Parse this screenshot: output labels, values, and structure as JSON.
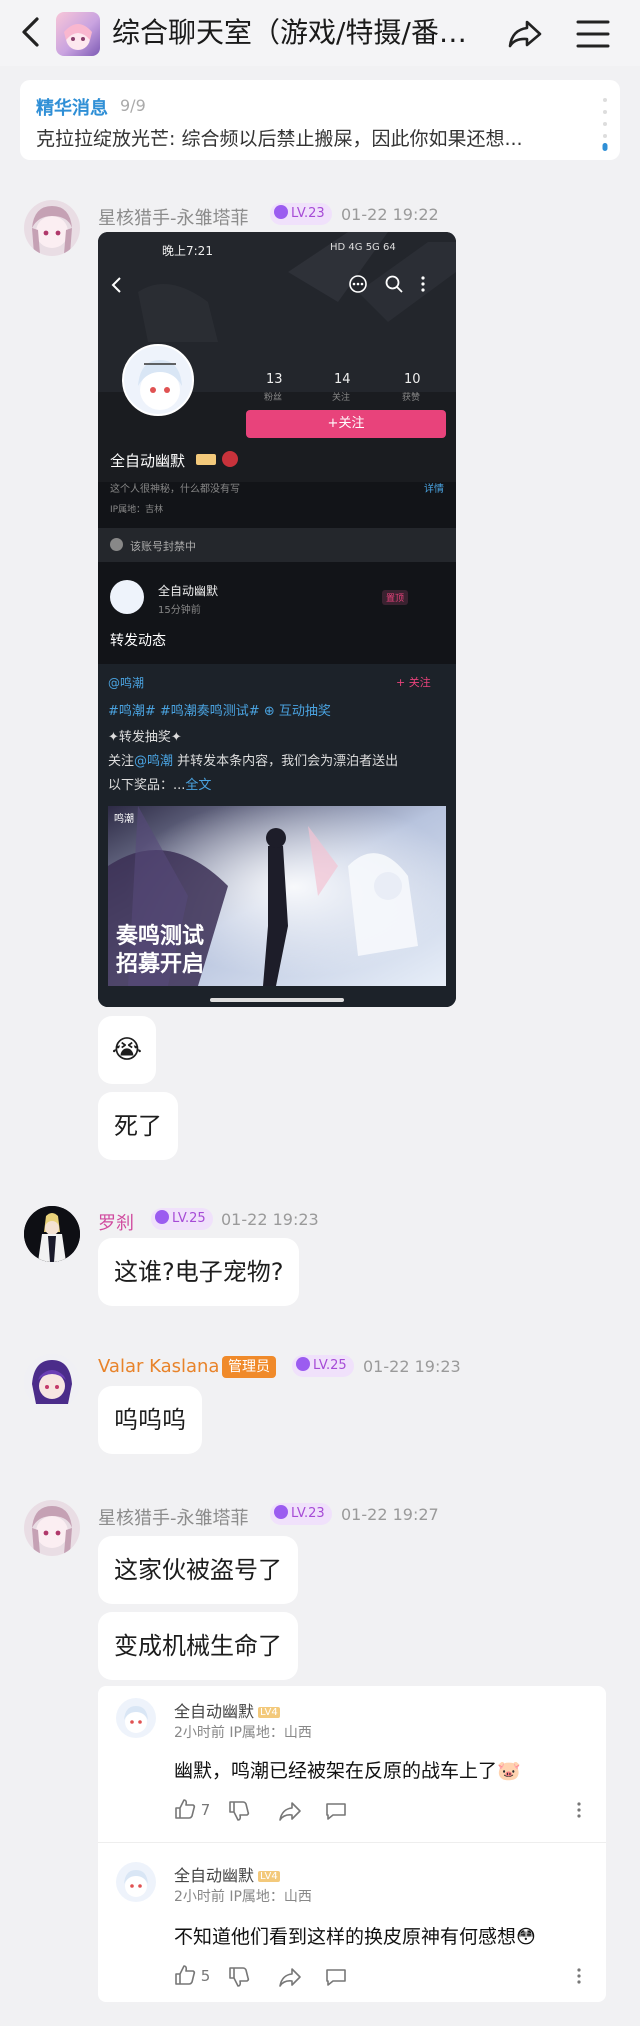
{
  "header": {
    "title": "综合聊天室（游戏/特摄/番剧/...",
    "back_icon": "back-icon",
    "share_icon": "share-icon",
    "menu_icon": "menu-icon"
  },
  "pinned": {
    "label": "精华消息",
    "count": "9/9",
    "text": "克拉拉绽放光芒: 综合频以后禁止搬屎，因此你如果还想..."
  },
  "messages": [
    {
      "user": "星核猎手-永雏塔菲",
      "level": "LV.23",
      "time": "01-22 19:22"
    },
    {
      "user": "罗刹",
      "level": "LV.25",
      "time": "01-22 19:23",
      "text": "这谁?电子宠物?"
    },
    {
      "user": "Valar Kaslana",
      "badge": "管理员",
      "level": "LV.25",
      "time": "01-22 19:23",
      "text": "呜呜呜"
    },
    {
      "user": "星核猎手-永雏塔菲",
      "level": "LV.23",
      "time": "01-22 19:27",
      "texts": [
        "这家伙被盗号了",
        "变成机械生命了"
      ]
    }
  ],
  "bubbles": {
    "emoji": "😭",
    "text": "死了"
  },
  "screenshot": {
    "status_time": "晚上7:21",
    "status_right": "HD 4G 5G 64",
    "stats": [
      {
        "num": "13",
        "label": "粉丝"
      },
      {
        "num": "14",
        "label": "关注"
      },
      {
        "num": "10",
        "label": "获赞"
      }
    ],
    "follow_button": "+关注",
    "name": "全自动幽默",
    "bio": "这个人很神秘，什么都没有写",
    "detail_link": "详情",
    "ip": "IP属地：吉林",
    "banned": "该账号封禁中",
    "post_user": "全自动幽默",
    "post_time": "15分钟前",
    "post_pin": "置顶",
    "post_text": "转发动态",
    "repost_at": "@鸣潮",
    "repost_follow": "+ 关注",
    "repost_tags": "#鸣潮# #鸣潮奏鸣测试# ⊕ 互动抽奖",
    "repost_lottery": "✦转发抽奖✦",
    "repost_line1_a": "关注",
    "repost_line1_at": "@鸣潮",
    "repost_line1_b": " 并转发本条内容，我们会为漂泊者送出",
    "repost_line2_a": "以下奖品：...",
    "repost_line2_more": "全文",
    "image_logo": "鸣潮",
    "image_title1": "奏鸣测试",
    "image_title2": "招募开启"
  },
  "comments": [
    {
      "user": "全自动幽默",
      "level_tag": "LV4",
      "meta": "2小时前  IP属地：山西",
      "text": "幽默，鸣潮已经被架在反原的战车上了🐷",
      "likes": "7"
    },
    {
      "user": "全自动幽默",
      "level_tag": "LV4",
      "meta": "2小时前  IP属地：山西",
      "text": "不知道他们看到这样的换皮原神有何感想😳",
      "likes": "5"
    }
  ],
  "colors": {
    "accent": "#2f8fd6",
    "pink_button": "#e8437b",
    "admin": "#f08a2a",
    "level": "#a64bd6"
  }
}
